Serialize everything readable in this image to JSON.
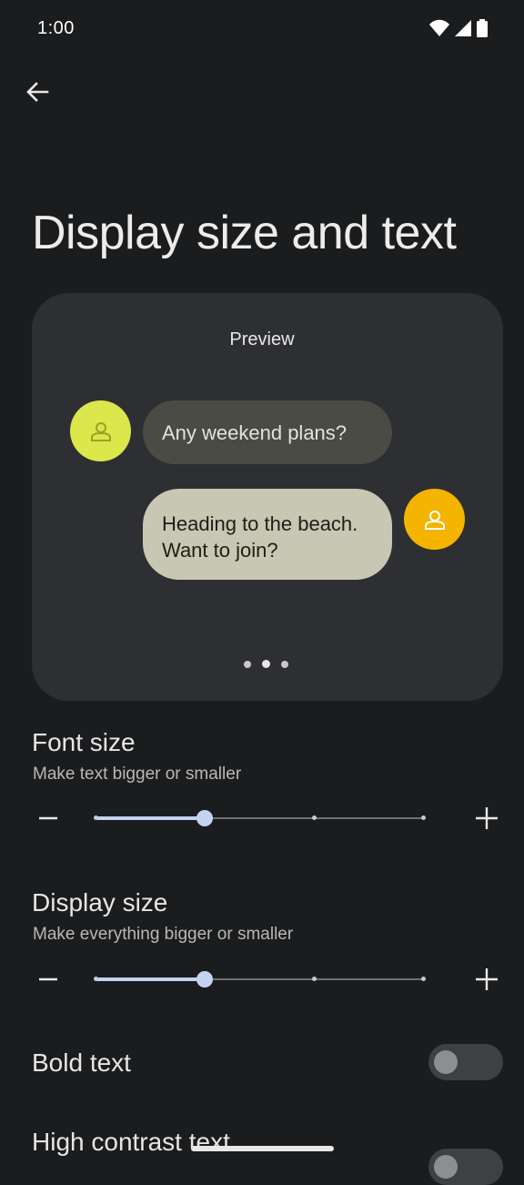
{
  "status_bar": {
    "time": "1:00"
  },
  "header": {
    "title": "Display size and text"
  },
  "preview": {
    "title": "Preview",
    "message_1": "Any weekend plans?",
    "message_2_line_1": "Heading to the beach.",
    "message_2_line_2": "Want to join?",
    "page_count": 3,
    "active_page": 2
  },
  "font_size": {
    "title": "Font size",
    "subtitle": "Make text bigger or smaller",
    "steps": 4,
    "selected_step": 2
  },
  "display_size": {
    "title": "Display size",
    "subtitle": "Make everything bigger or smaller",
    "steps": 4,
    "selected_step": 2
  },
  "bold_text": {
    "title": "Bold text",
    "enabled": false
  },
  "high_contrast_text": {
    "title": "High contrast text",
    "enabled": false
  },
  "colors": {
    "avatar_1": "#dbe74a",
    "avatar_2": "#f4b400",
    "slider_active": "#c5d3f2"
  }
}
